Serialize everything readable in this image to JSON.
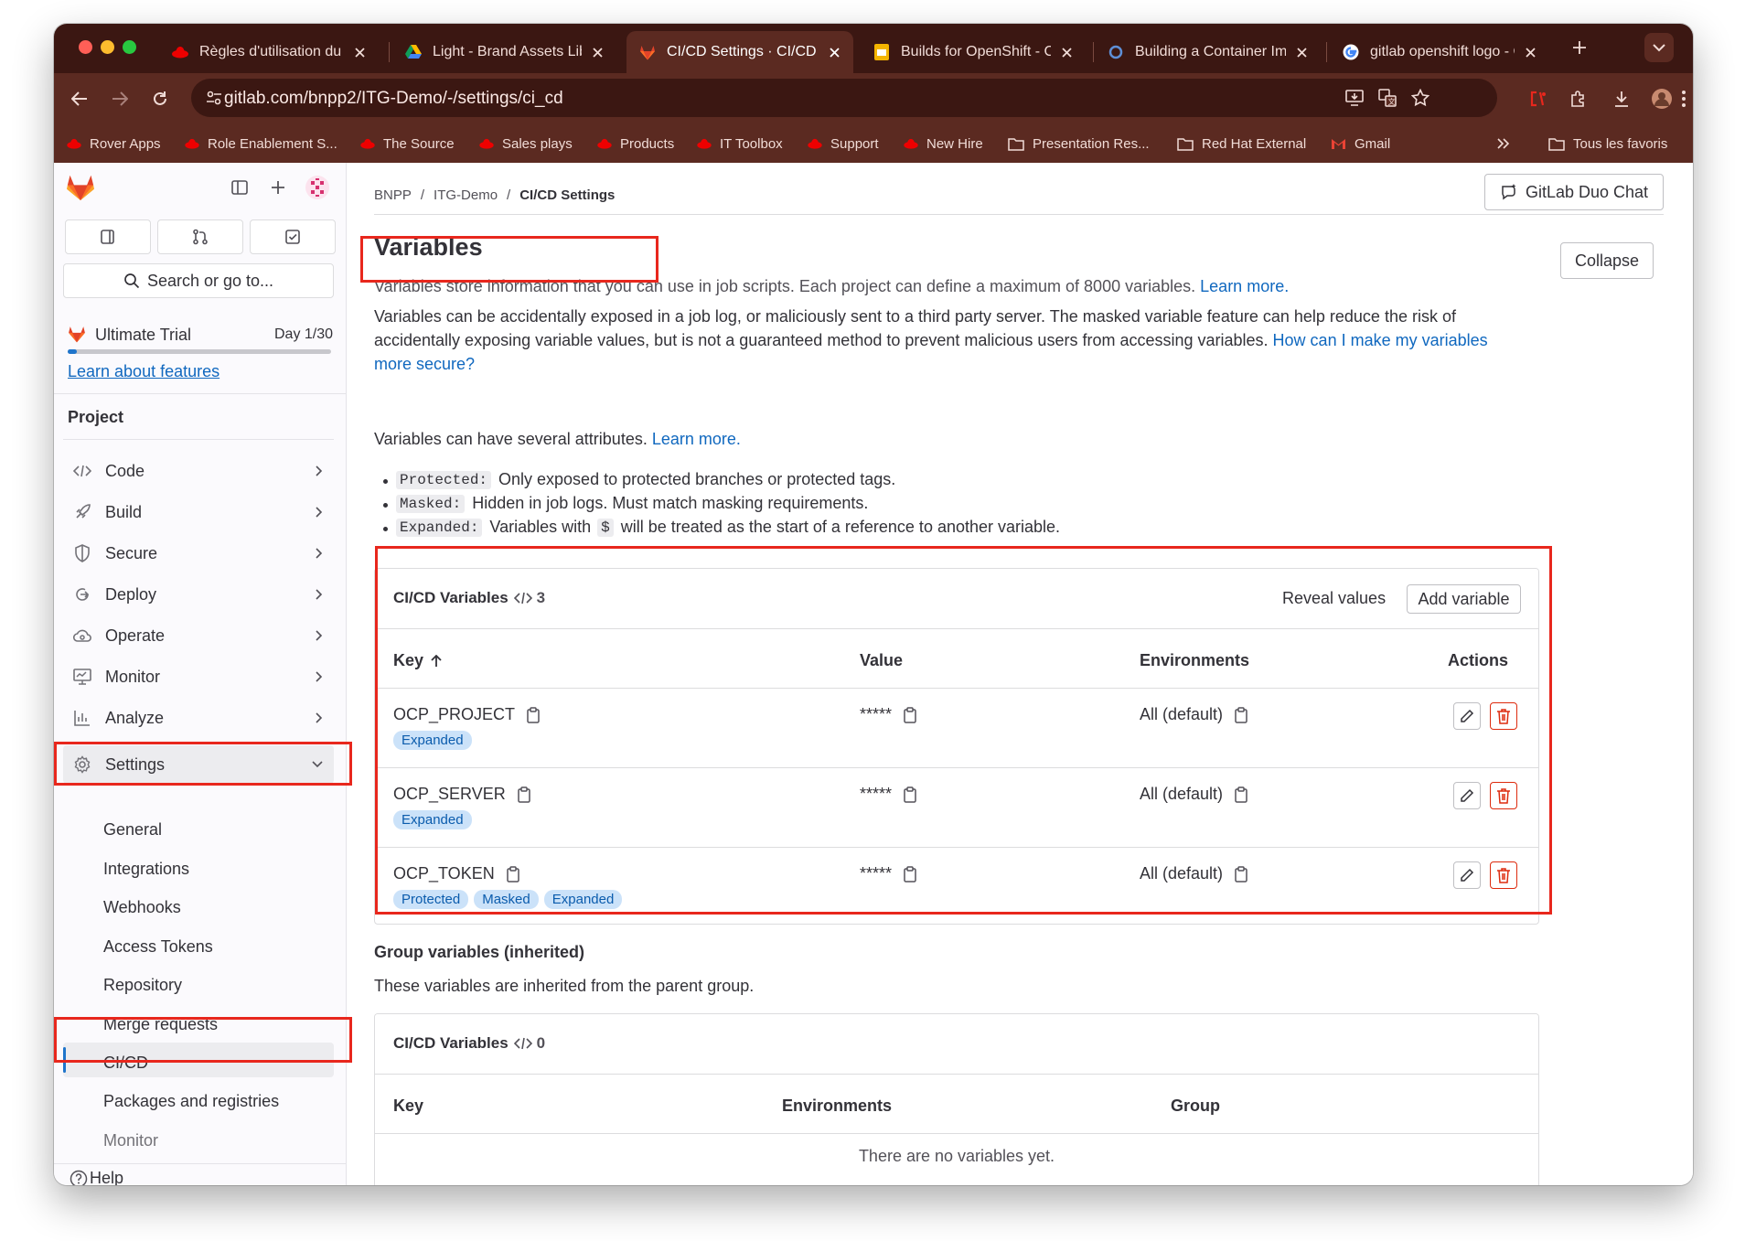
{
  "browser": {
    "tabs": [
      {
        "title": "Règles d'utilisation du l",
        "active": false
      },
      {
        "title": "Light - Brand Assets Lib",
        "active": false
      },
      {
        "title": "CI/CD Settings · CI/CD",
        "active": true
      },
      {
        "title": "Builds for OpenShift - C",
        "active": false
      },
      {
        "title": "Building a Container Im",
        "active": false
      },
      {
        "title": "gitlab openshift logo - C",
        "active": false
      }
    ],
    "url": "gitlab.com/bnpp2/ITG-Demo/-/settings/ci_cd",
    "bookmarks": [
      "Rover Apps",
      "Role Enablement S...",
      "The Source",
      "Sales plays",
      "Products",
      "IT Toolbox",
      "Support",
      "New Hire",
      "Presentation Res...",
      "Red Hat External",
      "Gmail"
    ],
    "all_bookmarks": "Tous les favoris",
    "chrome_color": "#3b1712"
  },
  "sidebar": {
    "search_placeholder": "Search or go to...",
    "trial_label": "Ultimate Trial",
    "trial_day": "Day 1/30",
    "trial_progress": 0.033,
    "learn_features": "Learn about features",
    "section": "Project",
    "items": [
      "Code",
      "Build",
      "Secure",
      "Deploy",
      "Operate",
      "Monitor",
      "Analyze",
      "Settings"
    ],
    "settings_sub": [
      "General",
      "Integrations",
      "Webhooks",
      "Access Tokens",
      "Repository",
      "Merge requests",
      "CI/CD",
      "Packages and registries",
      "Monitor"
    ],
    "help": "Help"
  },
  "header": {
    "breadcrumb": [
      "BNPP",
      "ITG-Demo",
      "CI/CD Settings"
    ],
    "duo_chat": "GitLab Duo Chat"
  },
  "variables": {
    "title": "Variables",
    "collapse": "Collapse",
    "desc": "Variables store information that you can use in job scripts. Each project can define a maximum of 8000 variables.",
    "learn_more": "Learn more.",
    "warning_line1": "Variables can be accidentally exposed in a job log, or maliciously sent to a third party server. The masked variable feature can help reduce the risk of",
    "warning_line2": "accidentally exposing variable values, but is not a guaranteed method to prevent malicious users from accessing variables.",
    "secure_link_a": "How can I make my variables",
    "secure_link_b": "more secure?",
    "attributes_intro": "Variables can have several attributes.",
    "attributes_link": "Learn more.",
    "attributes": [
      {
        "code": "Protected:",
        "text": "Only exposed to protected branches or protected tags."
      },
      {
        "code": "Masked:",
        "text": "Hidden in job logs. Must match masking requirements."
      },
      {
        "code": "Expanded:",
        "text_a": "Variables with",
        "code2": "$",
        "text_b": "will be treated as the start of a reference to another variable."
      }
    ]
  },
  "cicd_table": {
    "title": "CI/CD Variables",
    "count": "3",
    "reveal": "Reveal values",
    "add": "Add variable",
    "headers": {
      "key": "Key",
      "value": "Value",
      "env": "Environments",
      "actions": "Actions"
    },
    "rows": [
      {
        "key": "OCP_PROJECT",
        "value": "*****",
        "env": "All (default)",
        "badges": [
          "Expanded"
        ]
      },
      {
        "key": "OCP_SERVER",
        "value": "*****",
        "env": "All (default)",
        "badges": [
          "Expanded"
        ]
      },
      {
        "key": "OCP_TOKEN",
        "value": "*****",
        "env": "All (default)",
        "badges": [
          "Protected",
          "Masked",
          "Expanded"
        ]
      }
    ]
  },
  "group_vars": {
    "title": "Group variables (inherited)",
    "desc": "These variables are inherited from the parent group.",
    "card_title": "CI/CD Variables",
    "count": "0",
    "headers": {
      "key": "Key",
      "env": "Environments",
      "group": "Group"
    },
    "empty": "There are no variables yet."
  },
  "colors": {
    "highlight": "#e8271d",
    "link": "#1068bf",
    "badge_bg": "#cbe2f9",
    "danger": "#dd2b0e",
    "gitlab_orange": "#e24329"
  }
}
